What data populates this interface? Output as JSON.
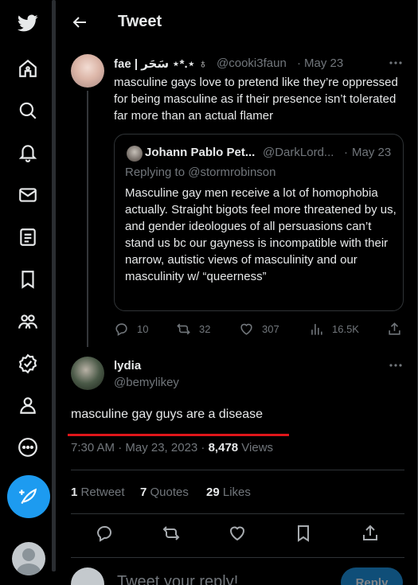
{
  "header": {
    "title": "Tweet"
  },
  "tweet1": {
    "name": "fae | سَحَر ⋆*.⋆ ♁",
    "handle": "@cooki3faun",
    "sep": "·",
    "date": "May 23",
    "text": "masculine gays love to pretend like they’re oppressed for being masculine as if their presence isn’t tolerated far more than an actual flamer",
    "quote": {
      "name": "Johann Pablo Pet...",
      "handle": "@DarkLord...",
      "sep": "·",
      "date": "May 23",
      "replying_to": "Replying to @stormrobinson",
      "text": "Masculine gay men receive a lot of homophobia actually. Straight bigots feel more threatened by us, and gender ideologues of all persuasions can’t stand us bc our gayness is incompatible with their narrow, autistic views of masculinity and our masculinity w/ “queerness”"
    },
    "actions": {
      "replies": "10",
      "retweets": "32",
      "likes": "307",
      "views": "16.5K"
    }
  },
  "tweet2": {
    "name": "lydia",
    "handle": "@bemylikey",
    "text": "masculine gay guys are a disease",
    "time": "7:30 AM · May 23, 2023 · ",
    "views_count": "8,478",
    "views_label": " Views",
    "stats": {
      "retweets_count": "1",
      "retweets_label": "Retweet",
      "quotes_count": "7",
      "quotes_label": "Quotes",
      "likes_count": "29",
      "likes_label": "Likes"
    }
  },
  "reply_box": {
    "placeholder": "Tweet your reply!",
    "button": "Reply"
  },
  "colors": {
    "accent": "#1d9bf0",
    "background": "#000000",
    "text": "#e7e9ea",
    "muted": "#71767b",
    "highlight": "#e0161a"
  },
  "icons": [
    "twitter-logo-icon",
    "home-icon",
    "search-icon",
    "notifications-icon",
    "messages-icon",
    "lists-icon",
    "bookmarks-icon",
    "communities-icon",
    "verified-icon",
    "profile-icon",
    "more-icon",
    "compose-icon"
  ]
}
